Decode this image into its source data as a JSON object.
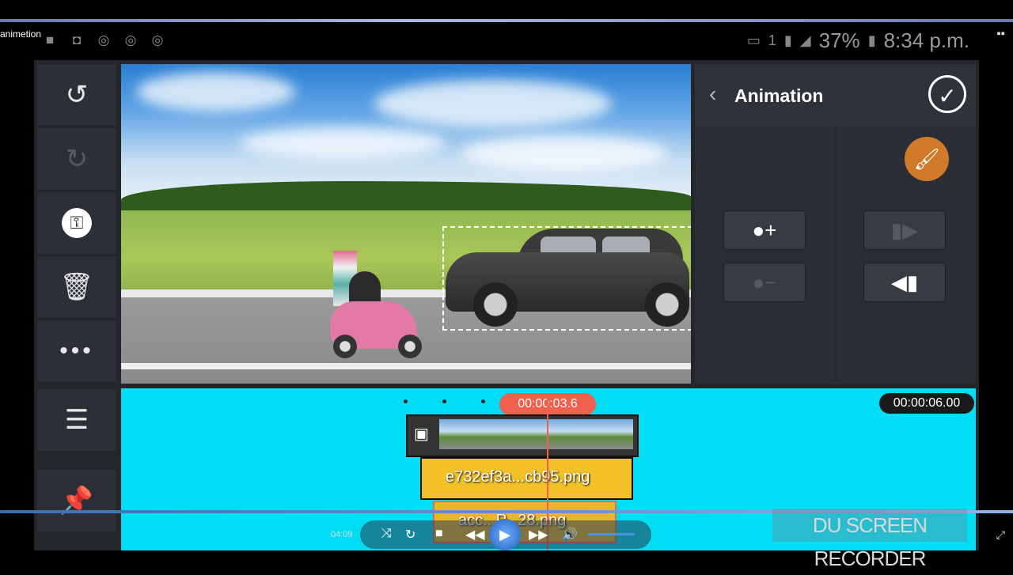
{
  "window": {
    "app_name": "animetion"
  },
  "status_bar": {
    "sim": "1",
    "battery": "37%",
    "time": "8:34 p.m."
  },
  "left_toolbar": {
    "undo_icon": "undo-icon",
    "redo_icon": "redo-icon",
    "keyframe_icon": "key-icon",
    "delete_icon": "trash-icon",
    "more_icon": "more-icon",
    "adjust_icon": "track-adjust-icon",
    "pin_icon": "pin-icon"
  },
  "panel": {
    "title": "Animation",
    "confirm_icon": "check-icon"
  },
  "timeline": {
    "playhead_time": "00:00:03.6",
    "total_time": "00:00:06.00",
    "tracks": [
      {
        "label": "e732ef3a...cb95.png"
      },
      {
        "label": "acc...P...28.png"
      }
    ]
  },
  "player": {
    "elapsed": "04:09"
  },
  "watermark": {
    "text": "DU SCREEN RECORDER"
  }
}
